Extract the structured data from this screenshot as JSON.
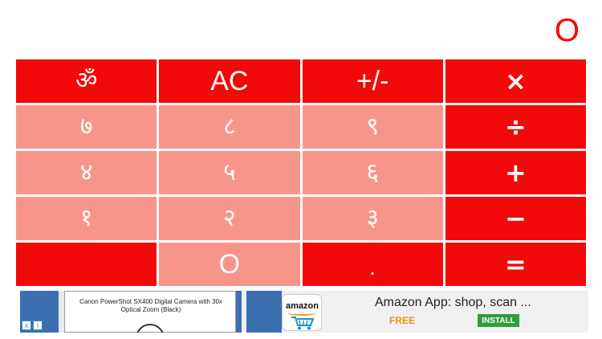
{
  "display": {
    "value": "O"
  },
  "keys": {
    "om": "ॐ",
    "ac": "AC",
    "sign": "+/-",
    "multiply": "×",
    "d7": "७",
    "d8": "८",
    "d9": "९",
    "divide": "÷",
    "d4": "४",
    "d5": "५",
    "d6": "६",
    "plus": "+",
    "d1": "१",
    "d2": "२",
    "d3": "३",
    "minus": "−",
    "blank": "",
    "d0": "O",
    "dot": ".",
    "equals": "="
  },
  "ad": {
    "product_text": "Canon PowerShot SX400 Digital Camera with 30x Optical Zoom (Black)",
    "brand": "amazon",
    "title": "Amazon App: shop, scan ...",
    "price": "FREE",
    "cta": "INSTALL",
    "adchoices_i": "i",
    "adchoices_x": "x"
  },
  "colors": {
    "key_red": "#f20909",
    "key_light": "#f8958a",
    "display_text": "#ff0000",
    "install_green": "#2e9e3e",
    "free_orange": "#e8961a"
  }
}
